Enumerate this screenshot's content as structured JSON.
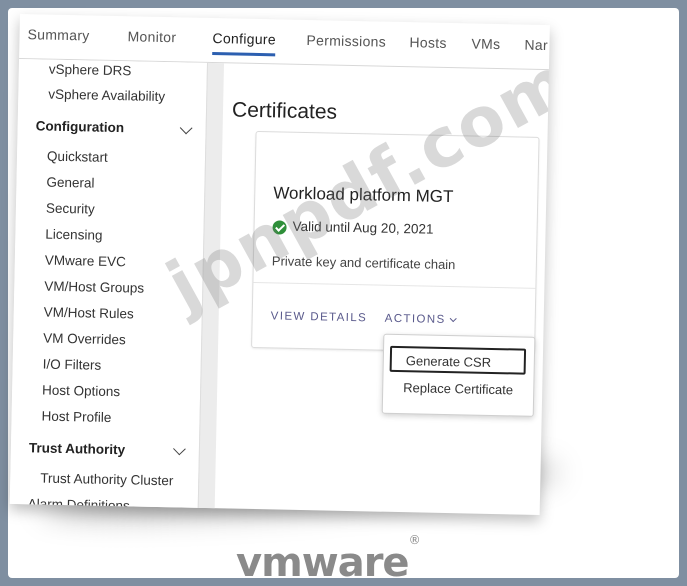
{
  "tabs": [
    {
      "label": "Summary"
    },
    {
      "label": "Monitor"
    },
    {
      "label": "Configure"
    },
    {
      "label": "Permissions"
    },
    {
      "label": "Hosts"
    },
    {
      "label": "VMs"
    },
    {
      "label": "Nar"
    }
  ],
  "sidebar": {
    "top_items": [
      {
        "label": "vSphere DRS"
      },
      {
        "label": "vSphere Availability"
      }
    ],
    "configuration": {
      "label": "Configuration",
      "items": [
        {
          "label": "Quickstart"
        },
        {
          "label": "General"
        },
        {
          "label": "Security"
        },
        {
          "label": "Licensing"
        },
        {
          "label": "VMware EVC"
        },
        {
          "label": "VM/Host Groups"
        },
        {
          "label": "VM/Host Rules"
        },
        {
          "label": "VM Overrides"
        },
        {
          "label": "I/O Filters"
        },
        {
          "label": "Host Options"
        },
        {
          "label": "Host Profile"
        }
      ]
    },
    "trust_authority": {
      "label": "Trust Authority",
      "items": [
        {
          "label": "Trust Authority Cluster"
        }
      ]
    },
    "bottom_item": {
      "label": "Alarm Definitions"
    }
  },
  "main": {
    "title": "Certificates",
    "card": {
      "title": "Workload platform MGT",
      "status": "Valid until Aug 20, 2021",
      "description": "Private key and certificate chain",
      "view_details": "VIEW DETAILS",
      "actions": "ACTIONS"
    },
    "dropdown": [
      {
        "label": "Generate CSR"
      },
      {
        "label": "Replace Certificate"
      }
    ]
  },
  "watermark": "jpnpdf.com",
  "logo": {
    "text": "vmware",
    "mark": "®"
  },
  "colors": {
    "accent": "#2c5fb0",
    "success": "#2f8f3a",
    "link": "#5a5a8c"
  }
}
